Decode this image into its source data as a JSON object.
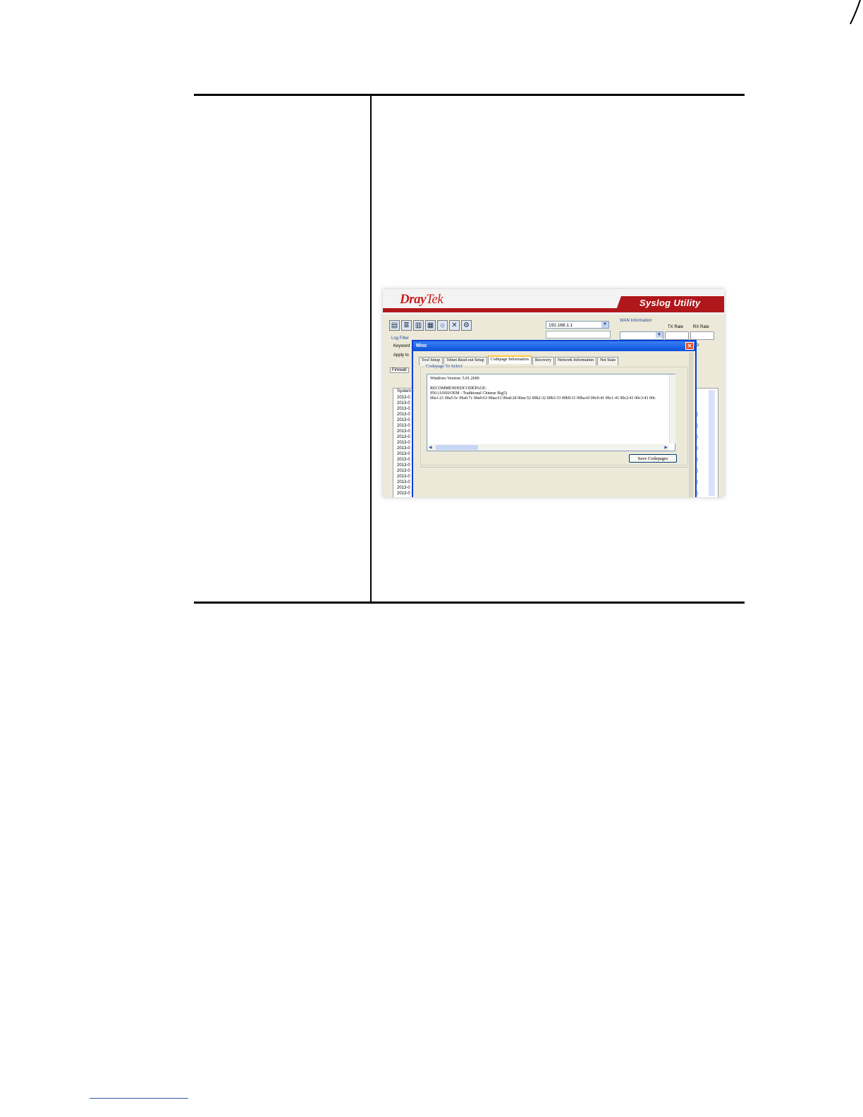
{
  "syslog": {
    "logo_dray": "Dray",
    "logo_tek": "Tek",
    "utility_title": "Syslog Utility",
    "ip_address": "192.168.1.1",
    "wan_information_label": "WAN Information",
    "tx_rate_label": "TX Rate",
    "rx_rate_label": "RX Rate",
    "p_label": "P",
    "log_filter_label": "Log Filter",
    "keyword_label": "Keyword",
    "apply_to_label": "Apply to",
    "firewall_tab": "Firewall",
    "list_header": "System",
    "list_rows": [
      "2013-0",
      "2013-0",
      "2013-0",
      "2013-0",
      "2013-0",
      "2013-0",
      "2013-0",
      "2013-0",
      "2013-0",
      "2013-0",
      "2013-0",
      "2013-0",
      "2013-0",
      "2013-0",
      "2013-0",
      "2013-0",
      "2013-0",
      "2013-0"
    ],
    "right_marks": [
      ")",
      ")",
      ")",
      ")",
      ")",
      ")",
      ")",
      ")"
    ],
    "colors": {
      "brand_red": "#b0171b",
      "dialog_blue": "#0a3fd6"
    }
  },
  "dialog": {
    "title": "Misc",
    "close_glyph": "✕",
    "tabs": [
      "Tool Setup",
      "Telnet Read-out Setup",
      "Codepage Information",
      "Recovery",
      "Network Information",
      "Net State"
    ],
    "active_tab": "Codepage Information",
    "group_label": "Codepage To Select",
    "text_lines": [
      "Windows Version: 5.01.2600",
      "",
      "RECOMMENDEDCODEPAGE:",
      "950    (ANSI/OEM - Traditional Chinese Big5)",
      "00a1:21 00a5:5c 00a6:7c 00a9:63 00aa:61 00ad:2d 00ae:52 00b2:32 00b3:33 00b9:31 00ba:6f 00c0:41 00c1:41 00c2:41 00c3:41 00c"
    ],
    "save_button": "Save Codepages"
  }
}
